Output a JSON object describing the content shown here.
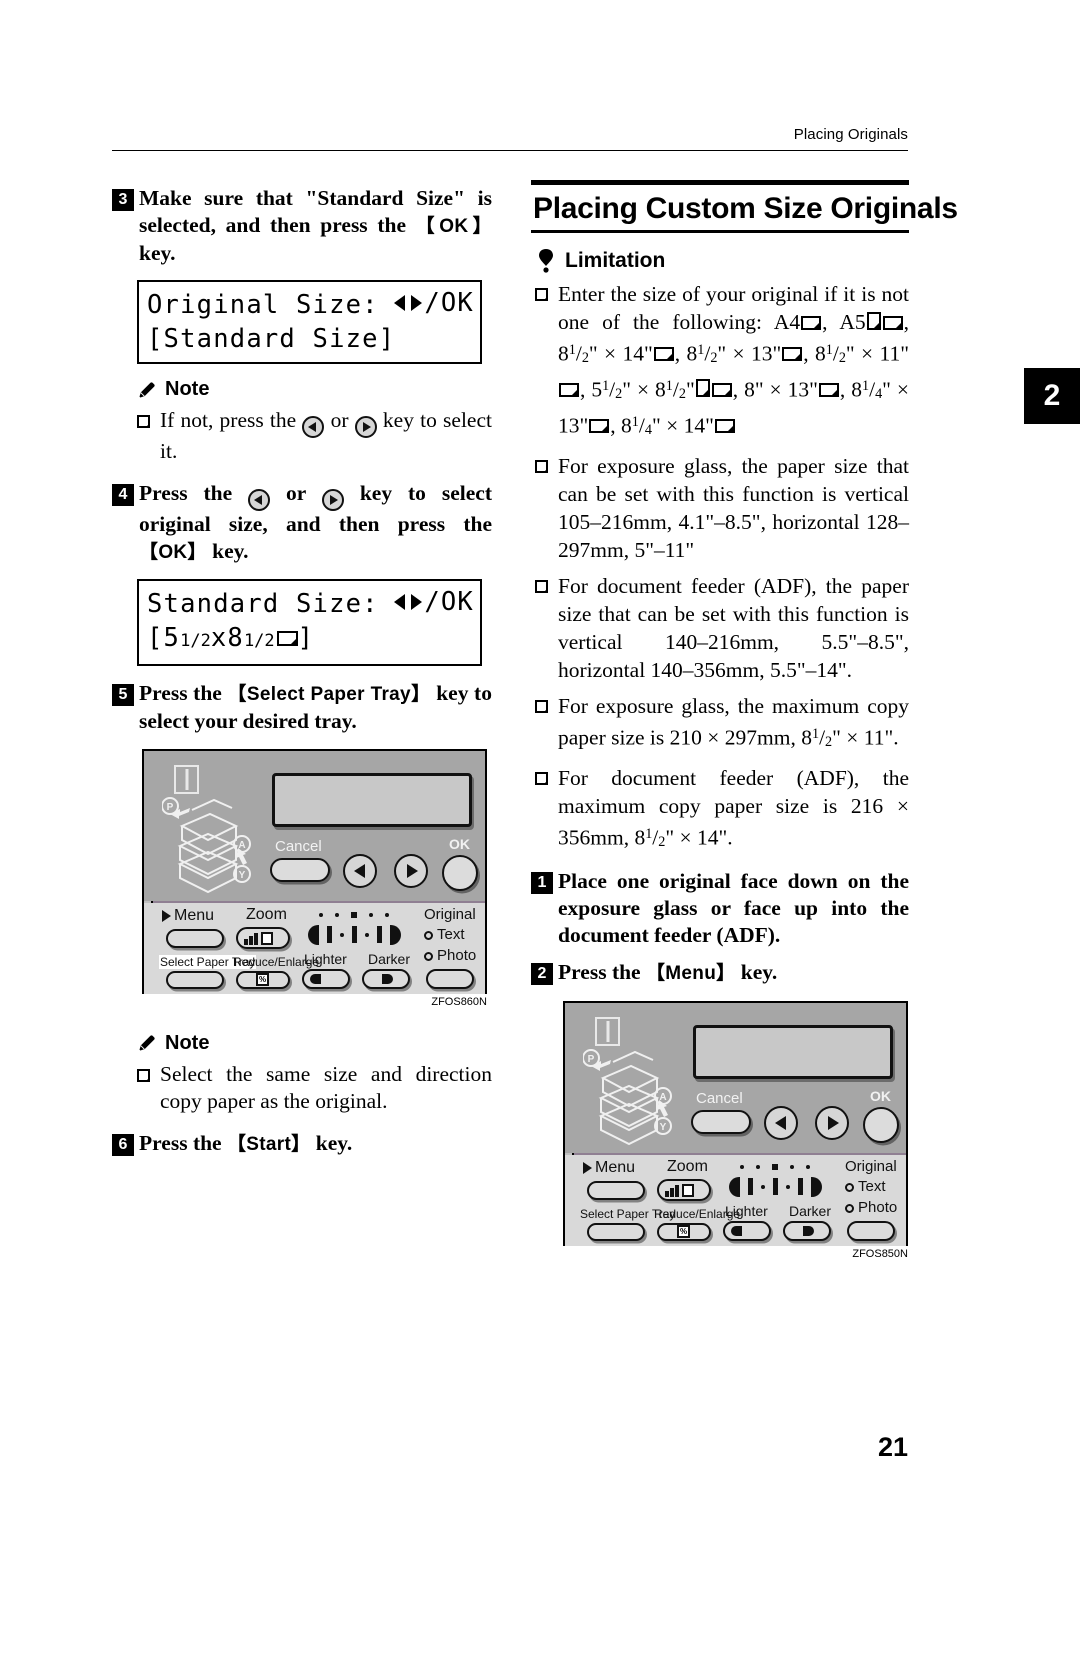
{
  "page": {
    "running_head": "Placing Originals",
    "chapter_tab": "2",
    "page_number": "21"
  },
  "left_column": {
    "step3": {
      "number": "3",
      "text_a": "Make sure that \"Standard Size\" is selected, and then press the ",
      "key": "OK",
      "text_b": " key."
    },
    "lcd1": {
      "line1_label": "Original Size:",
      "line1_right": "/OK",
      "line2": "[Standard Size]"
    },
    "note1": {
      "title": "Note",
      "items": [
        "If not, press the ◁ or ▷ key to select it."
      ],
      "item1_pre": "If not, press the ",
      "item1_mid": " or ",
      "item1_post": " key to select it."
    },
    "step4": {
      "number": "4",
      "text_a": "Press the ",
      "text_b": " or ",
      "text_c": " key to select original size, and then press the ",
      "key": "OK",
      "text_d": " key."
    },
    "lcd2": {
      "line1_label": "Standard Size:",
      "line1_right": "/OK",
      "line2_open": "[5",
      "line2_w": "1/2",
      "line2_x": "x8",
      "line2_h": "1/2",
      "line2_close": "]"
    },
    "step5": {
      "number": "5",
      "text_a": "Press the ",
      "key": "Select Paper Tray",
      "text_b": " key to select your desired tray."
    },
    "figure1": {
      "caption": "ZFOS860N",
      "labels": {
        "cancel": "Cancel",
        "ok": "OK",
        "menu": "Menu",
        "zoom": "Zoom",
        "select_paper_tray": "Select Paper Tray",
        "reduce_enlarge": "Reduce/Enlarge",
        "lighter": "Lighter",
        "darker": "Darker",
        "original": "Original",
        "text": "Text",
        "photo": "Photo"
      }
    },
    "note2": {
      "title": "Note",
      "item1": "Select the same size and direction copy paper as the original."
    },
    "step6": {
      "number": "6",
      "text_a": "Press the ",
      "key": "Start",
      "text_b": " key."
    }
  },
  "right_column": {
    "section_title": "Placing Custom Size Originals",
    "limitation_title": "Limitation",
    "limitations": [
      {
        "id": "sizes",
        "lead": "Enter the size of your original if it is not one of the following: A4",
        "list_text": "A4▭, A5▯▭, 8 1/2\" × 14\"▭, 8 1/2\" × 13\"▭, 8 1/2\" × 11\"▭, 5 1/2\" × 8 1/2\"▯▭, 8\" × 13\"▭, 8 1/4\" × 13\"▭, 8 1/4\" × 14\"▭"
      },
      {
        "id": "exposure-glass-range",
        "text": "For exposure glass, the paper size that can be set with this function is vertical 105–216mm, 4.1\"–8.5\", horizontal 128–297mm, 5\"–11\""
      },
      {
        "id": "adf-range",
        "text": "For document feeder (ADF), the paper size that can be set with this function is vertical 140–216mm, 5.5\"–8.5\", horizontal 140–356mm, 5.5\"–14\"."
      },
      {
        "id": "exposure-glass-max",
        "text_a": "For exposure glass, the maximum copy paper size is 210 × 297mm, 8",
        "frac": "1/2",
        "text_b": "\" × 11\"."
      },
      {
        "id": "adf-max",
        "text_a": "For document feeder (ADF), the maximum copy paper size is 216 × 356mm, 8",
        "frac": "1/2",
        "text_b": "\" × 14\"."
      }
    ],
    "step1": {
      "number": "1",
      "text": "Place one original face down on the exposure glass or face up into the document feeder (ADF)."
    },
    "step2": {
      "number": "2",
      "text_a": "Press the ",
      "key": "Menu",
      "text_b": " key."
    },
    "figure2": {
      "caption": "ZFOS850N",
      "labels": {
        "cancel": "Cancel",
        "ok": "OK",
        "menu": "Menu",
        "zoom": "Zoom",
        "select_paper_tray": "Select Paper Tray",
        "reduce_enlarge": "Reduce/Enlarge",
        "lighter": "Lighter",
        "darker": "Darker",
        "original": "Original",
        "text": "Text",
        "photo": "Photo"
      }
    }
  }
}
